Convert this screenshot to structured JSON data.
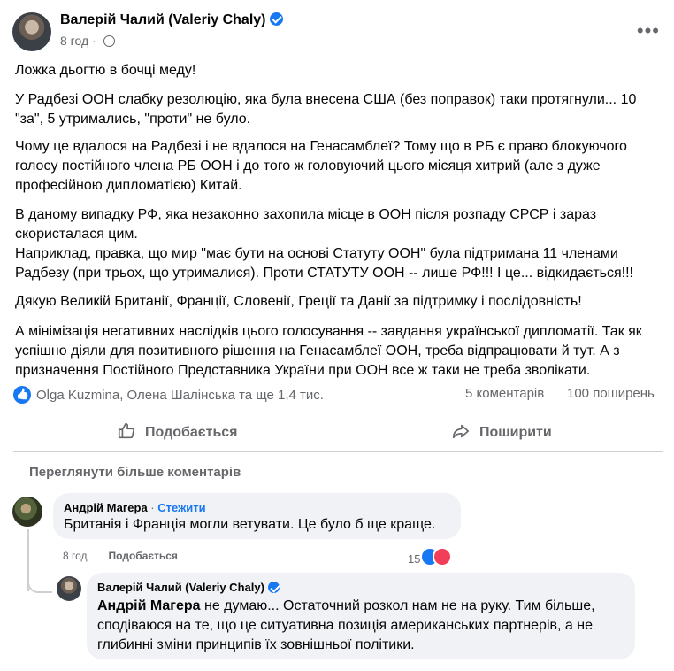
{
  "post": {
    "author": "Валерій Чалий (Valeriy Chaly)",
    "time": "8 год",
    "paragraphs": [
      "Ложка дьогтю в бочці меду!",
      "У Радбезі ООН слабку резолюцію, яка була внесена США (без поправок) таки протягнули... 10 \"за\", 5 утримались, \"проти\" не було.",
      "Чому це вдалося на Радбезі і не вдалося на Генасамблеї? Тому що в РБ є право блокуючого голосу постійного члена РБ ООН і до того ж головуючий цього місяця хитрий (але з дуже професійною дипломатією) Китай.",
      "В даному випадку РФ, яка незаконно захопила місце в ООН після розпаду СРСР і зараз скористалася цим.",
      "Наприклад, правка, що мир \"має бути на основі Статуту ООН\" була підтримана 11 членами Радбезу (при трьох, що утрималися). Проти СТАТУТУ ООН -- лише РФ!!! І це... відкидається!!!",
      "Дякую Великій Британії, Франції, Словенії, Греції та Данії за підтримку і послідовність!",
      "А мінімізація негативних наслідків цього голосування -- завдання української дипломатії. Так як успішно діяли для позитивного рішення на Генасамблеї ООН, треба відпрацювати й тут. А з призначення Постійного Представника України при ООН все ж таки не треба зволікати."
    ],
    "reactors": "Olga Kuzmina, Олена Шалінська та ще 1,4 тис.",
    "comments_count": "5 коментарів",
    "shares_count": "100 поширень"
  },
  "actions": {
    "like": "Подобається",
    "share": "Поширити"
  },
  "comments_section": {
    "view_more": "Переглянути більше коментарів"
  },
  "comments": [
    {
      "author": "Андрій Магера",
      "separator": " · ",
      "follow": "Стежити",
      "text": "Британія і Франція могли ветувати. Це було б ще краще.",
      "time": "8 год",
      "like": "Подобається",
      "reactions": "15"
    }
  ],
  "reply": {
    "author": "Валерій Чалий (Valeriy Chaly)",
    "mention": "Андрій Магера",
    "text": " не думаю... Остаточний розкол нам не на руку. Тим більше, сподіваюся на те, що це ситуативна позиція американських партнерів, а не глибинні зміни принципів їх зовнішньої політики."
  },
  "colors": {
    "link": "#1877f2",
    "secondary_text": "#65676b",
    "bubble": "#f0f2f5",
    "love": "#f33e58"
  }
}
